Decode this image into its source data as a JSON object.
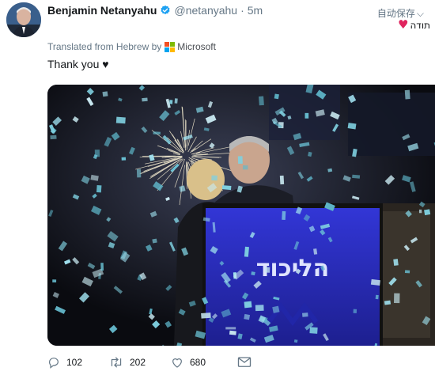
{
  "tweet": {
    "display_name": "Benjamin Netanyahu",
    "verified": true,
    "handle": "@netanyahu",
    "separator": "·",
    "time_ago": "5m",
    "translate_button": "自动保存",
    "original_text": "תודה",
    "translated_from": "Translated from Hebrew by",
    "translator": "Microsoft",
    "text": "Thank you ♥",
    "media": {
      "podium_text": "הליכוד",
      "type": "photo"
    },
    "actions": {
      "reply_count": "102",
      "retweet_count": "202",
      "like_count": "680"
    }
  },
  "colors": {
    "verified_blue": "#1da1f2",
    "heart_red": "#e0245e",
    "muted_text": "#657786",
    "podium_blue": "#2b2fc0"
  },
  "icons": {
    "verified": "verified-badge-icon",
    "heart": "heart-icon",
    "reply": "reply-icon",
    "retweet": "retweet-icon",
    "like": "like-icon",
    "message": "envelope-icon",
    "translator_logo": "microsoft-logo"
  }
}
